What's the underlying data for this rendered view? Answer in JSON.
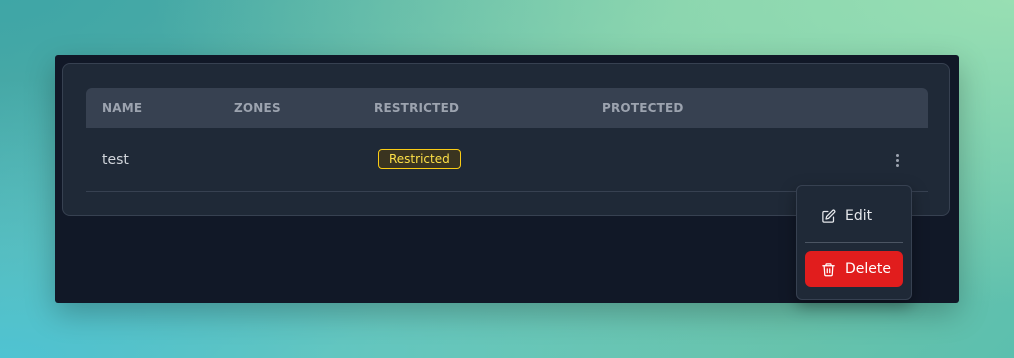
{
  "table": {
    "columns": [
      "NAME",
      "ZONES",
      "RESTRICTED",
      "PROTECTED"
    ],
    "rows": [
      {
        "name": "test",
        "zones": "",
        "restricted_badge": "Restricted",
        "protected": ""
      }
    ]
  },
  "menu": {
    "edit_label": "Edit",
    "delete_label": "Delete",
    "edit_icon": "pencil-square-icon",
    "delete_icon": "trash-icon",
    "row_actions_icon": "kebab-vertical-icon"
  },
  "colors": {
    "badge_border": "#facc15",
    "badge_text": "#fde047",
    "delete_bg": "#e11d1d",
    "window_bg": "#111827",
    "card_bg": "#1f2937",
    "header_bg": "#374151"
  }
}
